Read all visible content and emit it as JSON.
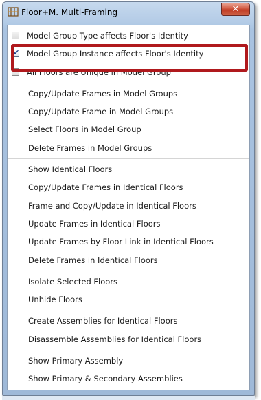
{
  "window": {
    "title": "Floor+M. Multi-Framing",
    "close_glyph": "✕"
  },
  "checkbox_items": [
    {
      "label": "Model Group Type affects Floor's Identity",
      "checked": false
    },
    {
      "label": "Model Group Instance affects Floor's Identity",
      "checked": true
    },
    {
      "label": "All Floors are Unique in Model Group",
      "checked": false
    }
  ],
  "sections": [
    {
      "items": [
        "Copy/Update Frames in Model Groups",
        "Copy/Update Frame in Model Groups",
        "Select Floors in Model Group",
        "Delete Frames in Model Groups"
      ]
    },
    {
      "items": [
        "Show Identical Floors",
        "Copy/Update Frames in Identical Floors",
        "Frame and Copy/Update in Identical Floors",
        "Update Frames  in  Identical  Floors",
        "Update Frames by Floor Link in Identical Floors",
        "Delete Frames in Identical Floors"
      ]
    },
    {
      "items": [
        "Isolate Selected Floors",
        "Unhide Floors"
      ]
    },
    {
      "items": [
        "Create Assemblies for Identical Floors",
        "Disassemble Assemblies for Identical Floors"
      ]
    },
    {
      "items": [
        "Show Primary Assembly",
        "Show Primary & Secondary Assemblies"
      ]
    }
  ],
  "icons": {
    "app": "frame-app-icon",
    "close": "close-icon",
    "check": "checkmark-icon"
  },
  "colors": {
    "highlight_border": "#b0191d",
    "close_button": "#c13d26",
    "checkmark": "#1d3f8a"
  }
}
